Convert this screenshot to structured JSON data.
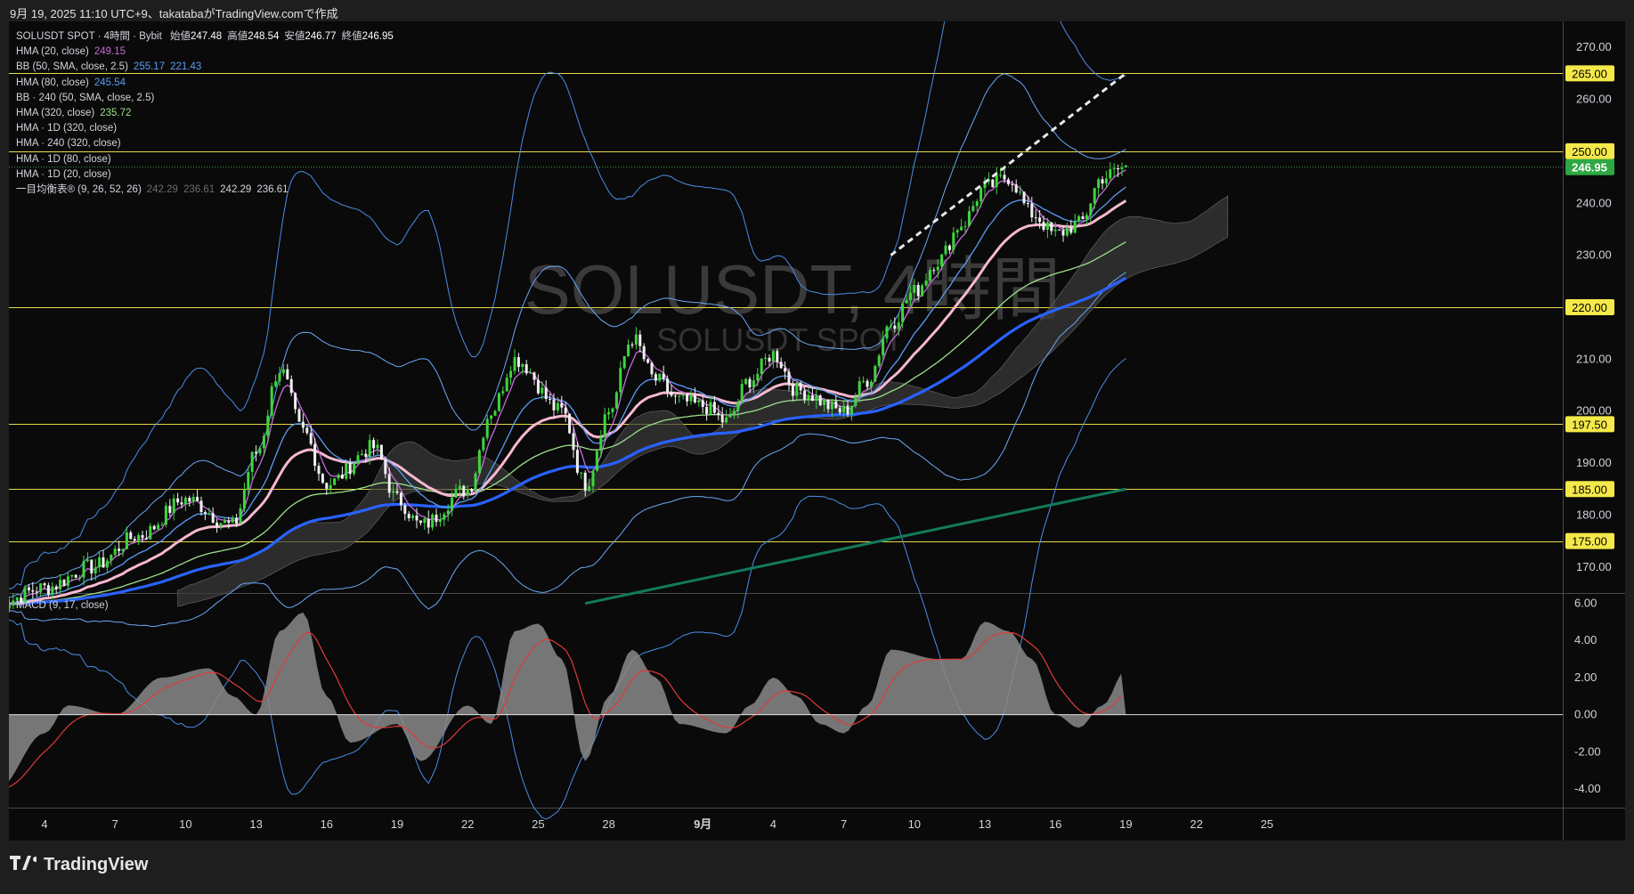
{
  "header": {
    "text": "9月 19, 2025 11:10 UTC+9、takatabaがTradingView.comで作成"
  },
  "watermark": {
    "symbol": "SOLUSDT, 4時間",
    "subtitle": "SOLUSDT SPOT"
  },
  "legend": {
    "title": "SOLUSDT SPOT · 4時間 · Bybit",
    "ohlc": [
      {
        "label": "始値",
        "value": "247.48"
      },
      {
        "label": "高値",
        "value": "248.54"
      },
      {
        "label": "安値",
        "value": "246.77"
      },
      {
        "label": "終値",
        "value": "246.95"
      }
    ],
    "indicators": [
      {
        "name": "HMA (20, close)",
        "values": [
          "249.15"
        ],
        "colors": [
          "#c36bd8"
        ]
      },
      {
        "name": "BB (50, SMA, close, 2.5)",
        "values": [
          "255.17",
          "221.43"
        ],
        "colors": [
          "#5b9cf6",
          "#5b9cf6"
        ]
      },
      {
        "name": "HMA (80, close)",
        "values": [
          "245.54"
        ],
        "colors": [
          "#5b9cf6"
        ]
      },
      {
        "name": "BB · 240 (50, SMA, close, 2.5)",
        "values": [],
        "colors": []
      },
      {
        "name": "HMA (320, close)",
        "values": [
          "235.72"
        ],
        "colors": [
          "#9be08a"
        ]
      },
      {
        "name": "HMA · 1D (320, close)",
        "values": [],
        "colors": []
      },
      {
        "name": "HMA · 240 (320, close)",
        "values": [],
        "colors": []
      },
      {
        "name": "HMA · 1D (80, close)",
        "values": [],
        "colors": []
      },
      {
        "name": "HMA · 1D (20, close)",
        "values": [],
        "colors": []
      },
      {
        "name": "一目均衡表® (9, 26, 52, 26)",
        "values": [
          "242.29",
          "236.61",
          "242.29",
          "236.61"
        ],
        "colors": [
          "#6b6b6b",
          "#6b6b6b",
          "#d1d4dc",
          "#d1d4dc"
        ]
      }
    ]
  },
  "macd_legend": "MACD (9, 17, close)",
  "price_axis": {
    "ticks": [
      "270.00",
      "260.00",
      "240.00",
      "230.00",
      "210.00",
      "200.00",
      "190.00",
      "180.00",
      "170.00"
    ],
    "tick_values": [
      270,
      260,
      240,
      230,
      210,
      200,
      190,
      180,
      170
    ],
    "level_labels": [
      "265.00",
      "250.00",
      "220.00",
      "197.50",
      "185.00",
      "175.00"
    ],
    "current_price": "246.95"
  },
  "macd_axis": {
    "ticks": [
      "6.00",
      "4.00",
      "2.00",
      "0.00",
      "-2.00",
      "-4.00"
    ],
    "tick_values": [
      6,
      4,
      2,
      0,
      -2,
      -4
    ]
  },
  "time_axis": {
    "labels": [
      "4",
      "7",
      "10",
      "13",
      "16",
      "19",
      "22",
      "25",
      "28",
      "9月",
      "4",
      "7",
      "10",
      "13",
      "16",
      "19",
      "22",
      "25"
    ]
  },
  "colors": {
    "bull": "#3fd43f",
    "bear": "#f0f0f0",
    "level": "#e8d94a",
    "bb": "#4a8de8",
    "hma20": "#c36bd8",
    "hma80": "#5b9cf6",
    "hma320": "#9be08a",
    "pink": "#f5b8cf",
    "blue_thick": "#2962ff",
    "teal": "#127a5a",
    "macd_hist": "#8a8a8a",
    "macd_signal": "#e03a3a"
  },
  "branding": {
    "logo": "TradingView"
  },
  "chart_data": {
    "type": "candlestick",
    "symbol": "SOLUSDT SPOT",
    "timeframe": "4時間",
    "exchange": "Bybit",
    "price_range": [
      165,
      275
    ],
    "last_price": 246.95,
    "horizontal_levels": [
      265,
      250,
      220,
      197.5,
      185,
      175
    ],
    "anchors": [
      {
        "date": "8/2",
        "price": 163
      },
      {
        "date": "8/4",
        "price": 166
      },
      {
        "date": "8/6",
        "price": 170
      },
      {
        "date": "8/8",
        "price": 176
      },
      {
        "date": "8/10",
        "price": 183
      },
      {
        "date": "8/12",
        "price": 178
      },
      {
        "date": "8/13",
        "price": 192
      },
      {
        "date": "8/14",
        "price": 208
      },
      {
        "date": "8/15",
        "price": 196
      },
      {
        "date": "8/16",
        "price": 186
      },
      {
        "date": "8/18",
        "price": 193
      },
      {
        "date": "8/19",
        "price": 183
      },
      {
        "date": "8/20",
        "price": 178
      },
      {
        "date": "8/22",
        "price": 185
      },
      {
        "date": "8/23",
        "price": 200
      },
      {
        "date": "8/24",
        "price": 210
      },
      {
        "date": "8/26",
        "price": 200
      },
      {
        "date": "8/27",
        "price": 186
      },
      {
        "date": "8/28",
        "price": 200
      },
      {
        "date": "8/29",
        "price": 214
      },
      {
        "date": "8/30",
        "price": 206
      },
      {
        "date": "8/31",
        "price": 202
      },
      {
        "date": "9/1",
        "price": 201
      },
      {
        "date": "9/2",
        "price": 198
      },
      {
        "date": "9/3",
        "price": 206
      },
      {
        "date": "9/4",
        "price": 211
      },
      {
        "date": "9/5",
        "price": 204
      },
      {
        "date": "9/7",
        "price": 200
      },
      {
        "date": "9/8",
        "price": 206
      },
      {
        "date": "9/9",
        "price": 217
      },
      {
        "date": "9/10",
        "price": 223
      },
      {
        "date": "9/11",
        "price": 229
      },
      {
        "date": "9/12",
        "price": 236
      },
      {
        "date": "9/13",
        "price": 243
      },
      {
        "date": "9/14",
        "price": 245
      },
      {
        "date": "9/15",
        "price": 238
      },
      {
        "date": "9/16",
        "price": 234
      },
      {
        "date": "9/17",
        "price": 236
      },
      {
        "date": "9/18",
        "price": 245
      },
      {
        "date": "9/19",
        "price": 246.95
      }
    ],
    "trendline": [
      {
        "date": "9/9",
        "price": 230
      },
      {
        "date": "9/19",
        "price": 265
      }
    ],
    "macd": {
      "name": "MACD (9, 17, close)",
      "range": [
        -5,
        6.5
      ],
      "histogram": [
        {
          "date": "8/2",
          "value": -4
        },
        {
          "date": "8/4",
          "value": -1
        },
        {
          "date": "8/5",
          "value": 0.5
        },
        {
          "date": "8/7",
          "value": 0
        },
        {
          "date": "8/9",
          "value": 2
        },
        {
          "date": "8/11",
          "value": 2.5
        },
        {
          "date": "8/12",
          "value": 1
        },
        {
          "date": "8/13",
          "value": 0
        },
        {
          "date": "8/14",
          "value": 4.5
        },
        {
          "date": "8/15",
          "value": 5.5
        },
        {
          "date": "8/16",
          "value": 1
        },
        {
          "date": "8/17",
          "value": -1.5
        },
        {
          "date": "8/19",
          "value": -0.5
        },
        {
          "date": "8/20",
          "value": -2.5
        },
        {
          "date": "8/22",
          "value": 0.5
        },
        {
          "date": "8/23",
          "value": -0.5
        },
        {
          "date": "8/24",
          "value": 4.5
        },
        {
          "date": "8/25",
          "value": 4.9
        },
        {
          "date": "8/26",
          "value": 3
        },
        {
          "date": "8/27",
          "value": -2.5
        },
        {
          "date": "8/28",
          "value": 1
        },
        {
          "date": "8/29",
          "value": 3.5
        },
        {
          "date": "8/30",
          "value": 2
        },
        {
          "date": "8/31",
          "value": -0.5
        },
        {
          "date": "9/2",
          "value": -1
        },
        {
          "date": "9/3",
          "value": 0.5
        },
        {
          "date": "9/4",
          "value": 2
        },
        {
          "date": "9/5",
          "value": 1
        },
        {
          "date": "9/6",
          "value": -0.5
        },
        {
          "date": "9/7",
          "value": -1
        },
        {
          "date": "9/8",
          "value": 0.5
        },
        {
          "date": "9/9",
          "value": 3.5
        },
        {
          "date": "9/11",
          "value": 3
        },
        {
          "date": "9/12",
          "value": 3
        },
        {
          "date": "9/13",
          "value": 5
        },
        {
          "date": "9/14",
          "value": 4.5
        },
        {
          "date": "9/15",
          "value": 3
        },
        {
          "date": "9/16",
          "value": 0
        },
        {
          "date": "9/17",
          "value": -0.7
        },
        {
          "date": "9/18",
          "value": 0.5
        },
        {
          "date": "9/19",
          "value": 2.4
        }
      ]
    }
  }
}
